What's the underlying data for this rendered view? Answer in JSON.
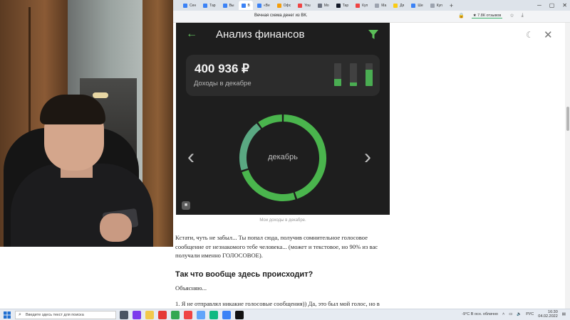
{
  "browser": {
    "tabs": [
      {
        "label": "Сен",
        "color": "#3b82f6",
        "active": false
      },
      {
        "label": "Тар",
        "color": "#3b82f6",
        "active": false
      },
      {
        "label": "Вы",
        "color": "#3b82f6",
        "active": false
      },
      {
        "label": "В",
        "color": "#3b82f6",
        "active": true
      },
      {
        "label": "«Ве",
        "color": "#3b82f6",
        "active": false
      },
      {
        "label": "Офс",
        "color": "#f59e0b",
        "active": false
      },
      {
        "label": "You",
        "color": "#ef4444",
        "active": false
      },
      {
        "label": "Мо",
        "color": "#6b7280",
        "active": false
      },
      {
        "label": "Тар",
        "color": "#111827",
        "active": false
      },
      {
        "label": "Куп",
        "color": "#ef4444",
        "active": false
      },
      {
        "label": "Ма",
        "color": "#9ca3af",
        "active": false
      },
      {
        "label": "Дя",
        "color": "#facc15",
        "active": false
      },
      {
        "label": "Ше",
        "color": "#3b82f6",
        "active": false
      },
      {
        "label": "Куп",
        "color": "#9ca3af",
        "active": false
      }
    ],
    "page_title": "Вечная схема денег из ВК.",
    "reviews_badge": "★ 7.8К отзывов"
  },
  "app": {
    "title": "Анализ финансов",
    "income_amount": "400 936 ₽",
    "income_label": "Доходы в декабре",
    "mini_bars": [
      0.3,
      0.15,
      0.72
    ],
    "donut_label": "декабрь",
    "donut_segments": [
      {
        "share": 0.45,
        "color": "#4ab54d"
      },
      {
        "share": 0.25,
        "color": "#4ab54d"
      },
      {
        "share": 0.2,
        "color": "#5aa882"
      },
      {
        "share": 0.1,
        "color": "#4ab54d"
      }
    ],
    "badge": "■"
  },
  "article": {
    "caption": "Мои доходы в декабре.",
    "p1": "Кстати, чуть не забыл... Ты попал сюда, получив сомнительное голосовое сообщение от незнакомого тебе человека... (может и текстовое, но 90% из вас получали именно ГОЛОСОВОЕ).",
    "h2": "Так что вообще здесь происходит?",
    "p2": "Объясняю...",
    "p3": "1. Я не отправлял никакие голосовые сообщения)) Да, это был мой голос, но в"
  },
  "taskbar": {
    "search_placeholder": "Введите здесь текст для поиска",
    "weather": "-9°C  В осн. облачно",
    "lang": "РУС",
    "time": "16:30",
    "date": "04.02.2022",
    "apps": [
      {
        "name": "task-view-icon",
        "color": "#4b5563"
      },
      {
        "name": "app-purple-icon",
        "color": "#7c3aed"
      },
      {
        "name": "explorer-icon",
        "color": "#f2c94c"
      },
      {
        "name": "yandex-browser-icon",
        "color": "#e53935",
        "active": true
      },
      {
        "name": "chrome-icon",
        "color": "#34a853"
      },
      {
        "name": "opera-icon",
        "color": "#ef4444"
      },
      {
        "name": "store-icon",
        "color": "#60a5fa"
      },
      {
        "name": "pycharm-icon",
        "color": "#10b981"
      },
      {
        "name": "code-icon",
        "color": "#3b82f6"
      },
      {
        "name": "obs-icon",
        "color": "#111111"
      }
    ]
  }
}
